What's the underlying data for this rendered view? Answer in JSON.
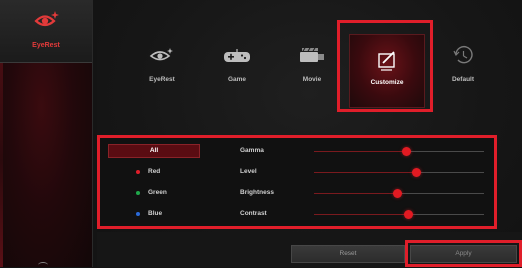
{
  "sidebar": {
    "active_item": {
      "icon": "eye-sparkle-icon",
      "label": "EyeRest",
      "color": "#e23a3a"
    }
  },
  "modes": [
    {
      "id": "eyerest",
      "label": "EyeRest",
      "icon": "eye-sparkle-icon",
      "active": false
    },
    {
      "id": "game",
      "label": "Game",
      "icon": "gamepad-icon",
      "active": false
    },
    {
      "id": "movie",
      "label": "Movie",
      "icon": "movie-icon",
      "active": false
    },
    {
      "id": "customize",
      "label": "Customize",
      "icon": "customize-pencil-icon",
      "active": true
    },
    {
      "id": "default",
      "label": "Default",
      "icon": "restore-clock-icon",
      "active": false
    }
  ],
  "channels": [
    {
      "label": "All",
      "selected": true
    },
    {
      "label": "Red",
      "dot_color": "#e01e2a",
      "selected": false
    },
    {
      "label": "Green",
      "dot_color": "#1fa84a",
      "selected": false
    },
    {
      "label": "Blue",
      "dot_color": "#2a6ad8",
      "selected": false
    }
  ],
  "sliders": [
    {
      "label": "Gamma",
      "value_fraction": 0.54
    },
    {
      "label": "Level",
      "value_fraction": 0.6
    },
    {
      "label": "Brightness",
      "value_fraction": 0.49
    },
    {
      "label": "Contrast",
      "value_fraction": 0.55
    }
  ],
  "buttons": {
    "reset": "Reset",
    "apply": "Apply"
  },
  "colors": {
    "accent": "#e01e2a",
    "highlight_box": "#e01e2a",
    "active_mode_bg": "#6a1218"
  }
}
